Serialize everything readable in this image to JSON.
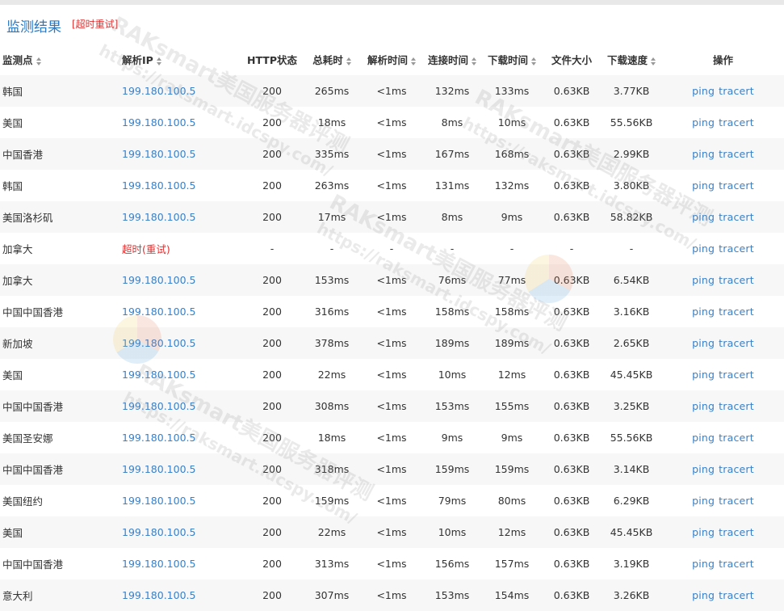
{
  "header": {
    "title": "监测结果",
    "timeout_retry": "[超时重试]"
  },
  "columns": [
    {
      "label": "监测点",
      "sortable": true
    },
    {
      "label": "解析IP",
      "sortable": true
    },
    {
      "label": "HTTP状态",
      "sortable": false
    },
    {
      "label": "总耗时",
      "sortable": true
    },
    {
      "label": "解析时间",
      "sortable": true
    },
    {
      "label": "连接时间",
      "sortable": true
    },
    {
      "label": "下载时间",
      "sortable": true
    },
    {
      "label": "文件大小",
      "sortable": false
    },
    {
      "label": "下载速度",
      "sortable": true
    },
    {
      "label": "操作",
      "sortable": false
    }
  ],
  "ops": {
    "ping": "ping",
    "tracert": "tracert"
  },
  "rows": [
    {
      "location": "韩国",
      "ip": "199.180.100.5",
      "status": "200",
      "total": "265ms",
      "dns": "<1ms",
      "connect": "132ms",
      "download": "133ms",
      "size": "0.63KB",
      "speed": "3.77KB"
    },
    {
      "location": "美国",
      "ip": "199.180.100.5",
      "status": "200",
      "total": "18ms",
      "dns": "<1ms",
      "connect": "8ms",
      "download": "10ms",
      "size": "0.63KB",
      "speed": "55.56KB"
    },
    {
      "location": "中国香港",
      "ip": "199.180.100.5",
      "status": "200",
      "total": "335ms",
      "dns": "<1ms",
      "connect": "167ms",
      "download": "168ms",
      "size": "0.63KB",
      "speed": "2.99KB"
    },
    {
      "location": "韩国",
      "ip": "199.180.100.5",
      "status": "200",
      "total": "263ms",
      "dns": "<1ms",
      "connect": "131ms",
      "download": "132ms",
      "size": "0.63KB",
      "speed": "3.80KB"
    },
    {
      "location": "美国洛杉矶",
      "ip": "199.180.100.5",
      "status": "200",
      "total": "17ms",
      "dns": "<1ms",
      "connect": "8ms",
      "download": "9ms",
      "size": "0.63KB",
      "speed": "58.82KB"
    },
    {
      "location": "加拿大",
      "ip": "超时(重试)",
      "status": "-",
      "total": "-",
      "dns": "-",
      "connect": "-",
      "download": "-",
      "size": "-",
      "speed": "-",
      "timeout": true
    },
    {
      "location": "加拿大",
      "ip": "199.180.100.5",
      "status": "200",
      "total": "153ms",
      "dns": "<1ms",
      "connect": "76ms",
      "download": "77ms",
      "size": "0.63KB",
      "speed": "6.54KB"
    },
    {
      "location": "中国中国香港",
      "ip": "199.180.100.5",
      "status": "200",
      "total": "316ms",
      "dns": "<1ms",
      "connect": "158ms",
      "download": "158ms",
      "size": "0.63KB",
      "speed": "3.16KB"
    },
    {
      "location": "新加坡",
      "ip": "199.180.100.5",
      "status": "200",
      "total": "378ms",
      "dns": "<1ms",
      "connect": "189ms",
      "download": "189ms",
      "size": "0.63KB",
      "speed": "2.65KB"
    },
    {
      "location": "美国",
      "ip": "199.180.100.5",
      "status": "200",
      "total": "22ms",
      "dns": "<1ms",
      "connect": "10ms",
      "download": "12ms",
      "size": "0.63KB",
      "speed": "45.45KB"
    },
    {
      "location": "中国中国香港",
      "ip": "199.180.100.5",
      "status": "200",
      "total": "308ms",
      "dns": "<1ms",
      "connect": "153ms",
      "download": "155ms",
      "size": "0.63KB",
      "speed": "3.25KB"
    },
    {
      "location": "美国圣安娜",
      "ip": "199.180.100.5",
      "status": "200",
      "total": "18ms",
      "dns": "<1ms",
      "connect": "9ms",
      "download": "9ms",
      "size": "0.63KB",
      "speed": "55.56KB"
    },
    {
      "location": "中国中国香港",
      "ip": "199.180.100.5",
      "status": "200",
      "total": "318ms",
      "dns": "<1ms",
      "connect": "159ms",
      "download": "159ms",
      "size": "0.63KB",
      "speed": "3.14KB"
    },
    {
      "location": "美国纽约",
      "ip": "199.180.100.5",
      "status": "200",
      "total": "159ms",
      "dns": "<1ms",
      "connect": "79ms",
      "download": "80ms",
      "size": "0.63KB",
      "speed": "6.29KB"
    },
    {
      "location": "美国",
      "ip": "199.180.100.5",
      "status": "200",
      "total": "22ms",
      "dns": "<1ms",
      "connect": "10ms",
      "download": "12ms",
      "size": "0.63KB",
      "speed": "45.45KB"
    },
    {
      "location": "中国中国香港",
      "ip": "199.180.100.5",
      "status": "200",
      "total": "313ms",
      "dns": "<1ms",
      "connect": "156ms",
      "download": "157ms",
      "size": "0.63KB",
      "speed": "3.19KB"
    },
    {
      "location": "意大利",
      "ip": "199.180.100.5",
      "status": "200",
      "total": "307ms",
      "dns": "<1ms",
      "connect": "153ms",
      "download": "154ms",
      "size": "0.63KB",
      "speed": "3.26KB"
    }
  ],
  "watermark": [
    "RAKsmart美国服务器评测",
    "https://raksmart.idcspy.com/"
  ]
}
